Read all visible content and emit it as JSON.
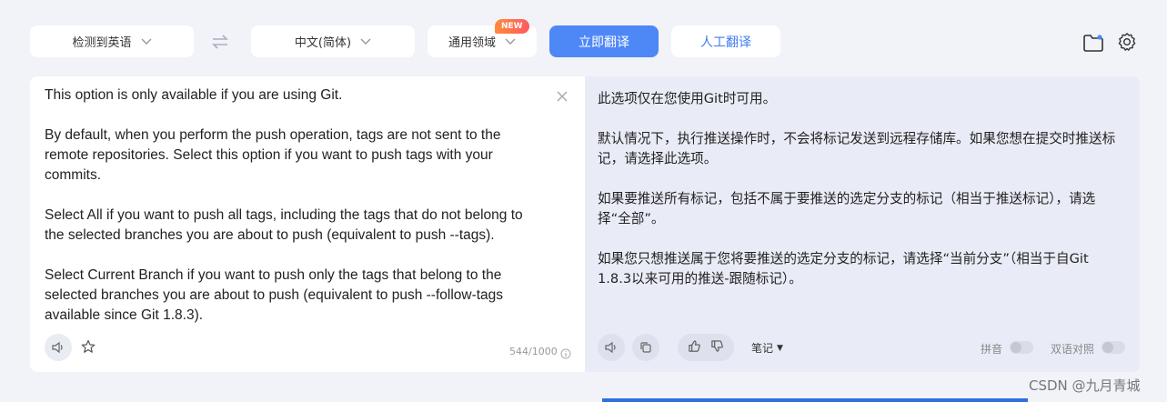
{
  "toolbar": {
    "source_language": "检测到英语",
    "target_language": "中文(简体)",
    "domain": "通用领域",
    "domain_badge": "NEW",
    "translate_button": "立即翻译",
    "human_translate_button": "人工翻译",
    "icons": [
      "swap-icon",
      "chevron-down-icon",
      "folder-icon",
      "gear-icon"
    ]
  },
  "source": {
    "paragraphs": [
      "This option is only available if you are using Git.",
      "By default, when you perform the push operation, tags are not sent to the remote repositories. Select this option if you want to push tags with your commits.",
      "Select All if you want to push all tags, including the tags that do not belong to the selected branches you are about to push (equivalent to push --tags).",
      "Select Current Branch if you want to push only the tags that belong to the selected branches you are about to push (equivalent to push --follow-tags available since Git 1.8.3)."
    ],
    "char_count": "544/1000",
    "icons": [
      "close-icon",
      "speaker-icon",
      "star-icon",
      "info-icon"
    ]
  },
  "target": {
    "paragraphs": [
      "此选项仅在您使用Git时可用。",
      "默认情况下，执行推送操作时，不会将标记发送到远程存储库。如果您想在提交时推送标记，请选择此选项。",
      "如果要推送所有标记，包括不属于要推送的选定分支的标记（相当于推送标记），请选择“全部”。",
      "如果您只想推送属于您将要推送的选定分支的标记，请选择“当前分支”（相当于自Git 1.8.3以来可用的推送-跟随标记）。"
    ],
    "notes_label": "笔记",
    "pinyin_label": "拼音",
    "bilingual_label": "双语对照",
    "pinyin_on": false,
    "bilingual_on": false,
    "icons": [
      "speaker-icon",
      "copy-icon",
      "thumbs-up-icon",
      "thumbs-down-icon"
    ]
  },
  "watermark": "CSDN @九月青城",
  "colors": {
    "primary": "#4e88f6",
    "link": "#3f7cf2",
    "page_bg": "#f1f3f9",
    "result_bg": "#e9ecf6",
    "badge_start": "#ff8a3d",
    "badge_end": "#ff5a5f"
  }
}
